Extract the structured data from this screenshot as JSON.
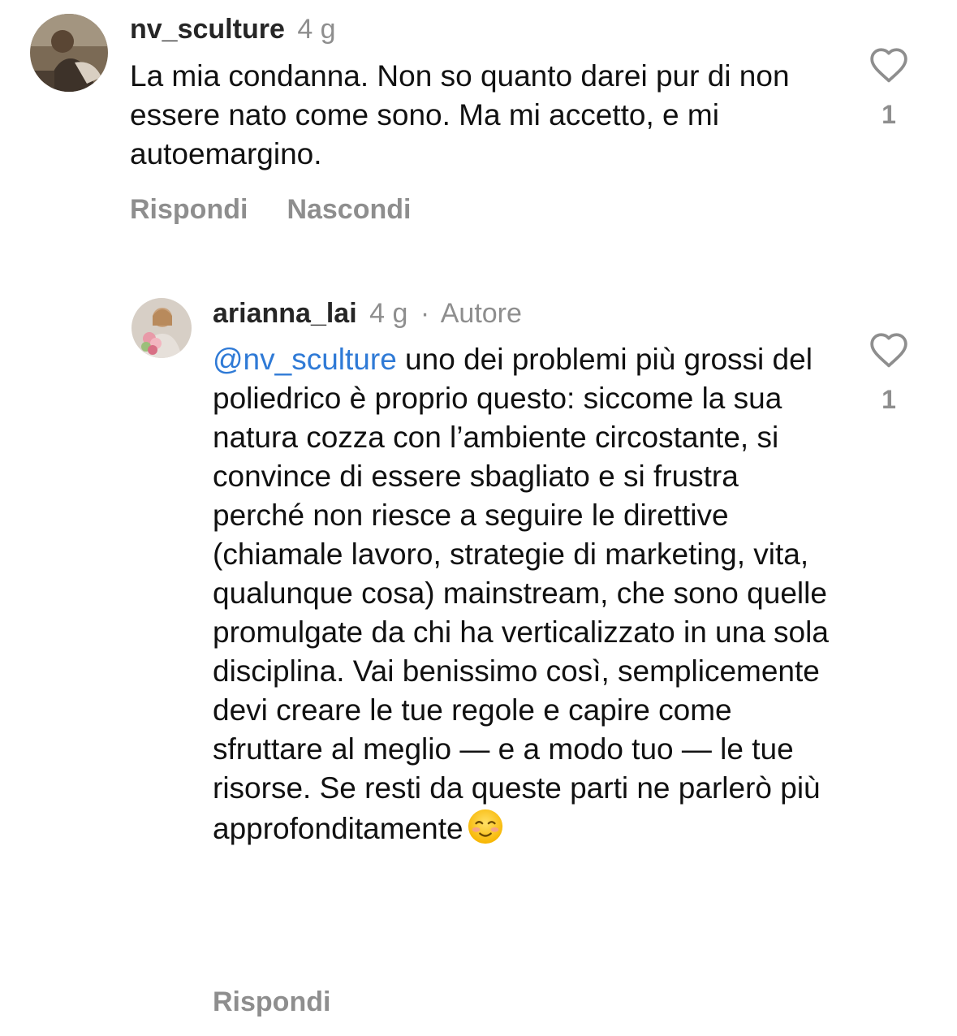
{
  "comments": [
    {
      "username": "nv_sculture",
      "time": "4 g",
      "text": "La mia condanna. Non so quanto darei pur di non essere nato come sono. Ma mi accetto, e mi autoemargino.",
      "like_count": "1",
      "actions": {
        "reply": "Rispondi",
        "hide": "Nascondi"
      }
    }
  ],
  "reply": {
    "username": "arianna_lai",
    "time": "4 g",
    "separator": "·",
    "badge": "Autore",
    "mention": "@nv_sculture",
    "text": " uno dei problemi più grossi del poliedrico è proprio questo: siccome la sua natura cozza con l’ambiente circostante, si convince di essere sbagliato e si frustra perché non riesce a seguire le direttive (chiamale lavoro, strategie di marketing, vita, qualunque cosa) mainstream, che sono quelle promulgate da chi ha verticalizzato in una sola disciplina. Vai benissimo così, semplicemente devi creare le tue regole e capire come sfruttare al meglio — e a modo tuo — le tue risorse. Se resti da queste parti ne parlerò più approfonditamente",
    "emoji": "smiling-face-icon",
    "like_count": "1",
    "actions": {
      "reply": "Rispondi"
    }
  },
  "icons": {
    "like": "heart-outline-icon"
  },
  "colors": {
    "mention": "#2f7ad6",
    "secondary_text": "#8e8e8e",
    "primary_text": "#111111"
  }
}
